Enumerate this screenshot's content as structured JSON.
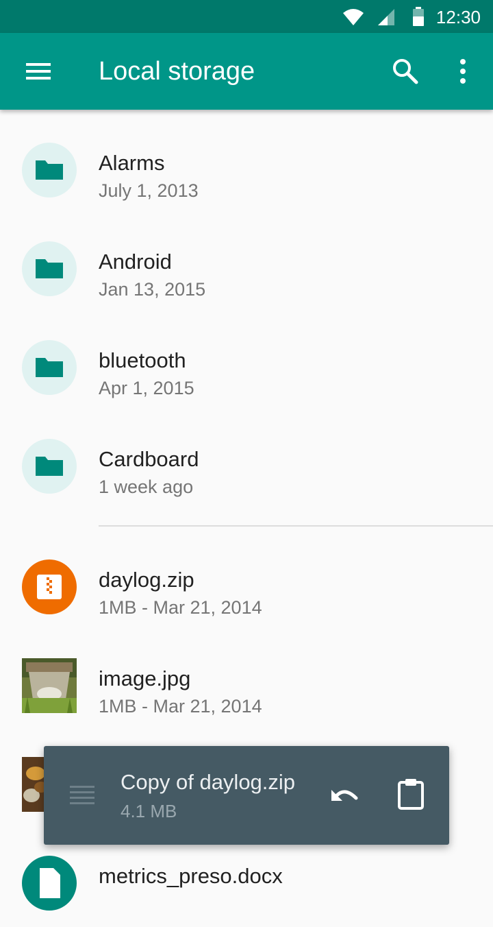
{
  "status_bar": {
    "time": "12:30",
    "icons": [
      "wifi-icon",
      "cell-signal-icon",
      "battery-icon"
    ]
  },
  "app_bar": {
    "title": "Local storage",
    "icons": [
      "menu-icon",
      "search-icon",
      "more-vert-icon"
    ],
    "color": "#009688"
  },
  "files": {
    "folders": [
      {
        "name": "Alarms",
        "meta": "July 1, 2013",
        "icon": "folder-icon"
      },
      {
        "name": "Android",
        "meta": "Jan 13, 2015",
        "icon": "folder-icon"
      },
      {
        "name": "bluetooth",
        "meta": "Apr 1, 2015",
        "icon": "folder-icon"
      },
      {
        "name": "Cardboard",
        "meta": "1 week ago",
        "icon": "folder-icon"
      }
    ],
    "items": [
      {
        "name": "daylog.zip",
        "meta": "1MB - Mar 21, 2014",
        "icon": "zip-icon"
      },
      {
        "name": "image.jpg",
        "meta": "1MB - Mar 21, 2014",
        "icon": "image-thumbnail"
      },
      {
        "name": "",
        "meta": "",
        "icon": "image-thumbnail"
      },
      {
        "name": "metrics_preso.docx",
        "meta": "",
        "icon": "doc-icon"
      }
    ]
  },
  "snackbar": {
    "title": "Copy of daylog.zip",
    "size": "4.1 MB",
    "icons": [
      "drag-handle-icon",
      "undo-icon",
      "clipboard-icon"
    ],
    "color": "#455a64"
  }
}
